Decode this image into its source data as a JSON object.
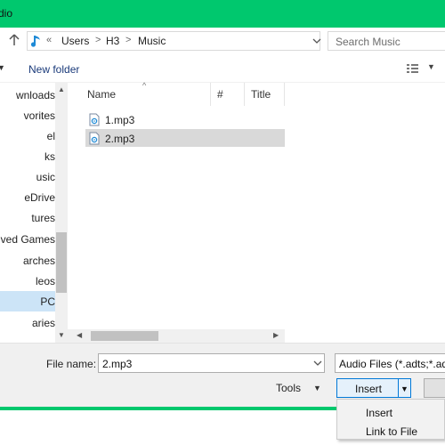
{
  "window": {
    "title": "dio"
  },
  "address": {
    "breadcrumbs": [
      "Users",
      "H3",
      "Music"
    ],
    "overflow": "«",
    "separator": ">",
    "search_placeholder": "Search Music"
  },
  "toolbar": {
    "new_folder": "New folder"
  },
  "nav": {
    "items": [
      {
        "label": "wnloads",
        "selected": false
      },
      {
        "label": "vorites",
        "selected": false
      },
      {
        "label": "el",
        "selected": false
      },
      {
        "label": "ks",
        "selected": false
      },
      {
        "label": "usic",
        "selected": false
      },
      {
        "label": "eDrive",
        "selected": false
      },
      {
        "label": "tures",
        "selected": false
      },
      {
        "label": "ved Games",
        "selected": false
      },
      {
        "label": "arches",
        "selected": false
      },
      {
        "label": "leos",
        "selected": false
      },
      {
        "label": "PC",
        "selected": true
      },
      {
        "label": "aries",
        "selected": false
      }
    ]
  },
  "files": {
    "columns": [
      "Name",
      "#",
      "Title"
    ],
    "rows": [
      {
        "name": "1.mp3",
        "selected": false
      },
      {
        "name": "2.mp3",
        "selected": true
      }
    ]
  },
  "bottom": {
    "file_name_label": "File name:",
    "file_name_value": "2.mp3",
    "filter": "Audio Files (*.adts;*.adt",
    "tools_label": "Tools",
    "insert_label": "Insert"
  },
  "menu": {
    "items": [
      "Insert",
      "Link to File"
    ]
  },
  "colors": {
    "accent": "#00c86e",
    "selection": "#cce4f7",
    "button_border": "#0078d7"
  }
}
